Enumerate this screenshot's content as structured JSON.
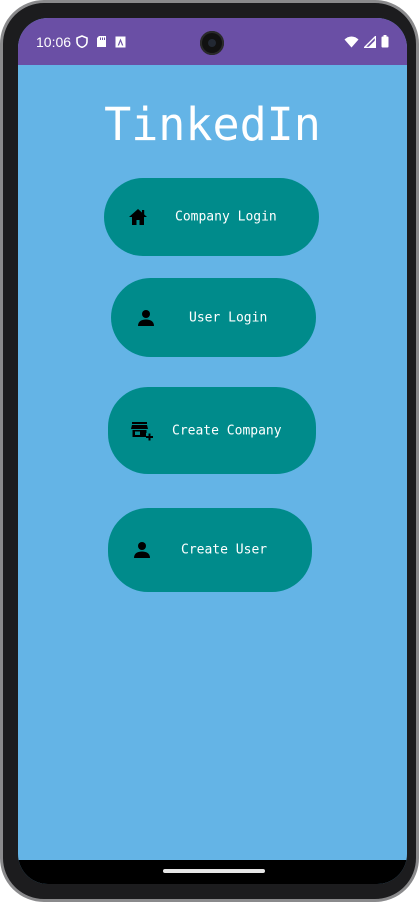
{
  "status_bar": {
    "time": "10:06",
    "left_icons": [
      "shield-icon",
      "sd-card-icon",
      "app-notification-icon"
    ],
    "right_icons": [
      "wifi-icon",
      "signal-icon",
      "battery-icon"
    ]
  },
  "app": {
    "title": "TinkedIn"
  },
  "buttons": {
    "company_login": {
      "label": "Company Login",
      "icon": "home-icon"
    },
    "user_login": {
      "label": "User Login",
      "icon": "person-icon"
    },
    "create_company": {
      "label": "Create Company",
      "icon": "store-add-icon"
    },
    "create_user": {
      "label": "Create User",
      "icon": "person-icon"
    }
  },
  "colors": {
    "status_bar": "#6a4fa5",
    "background": "#64b4e6",
    "button": "#008b8b",
    "text": "#ffffff"
  }
}
